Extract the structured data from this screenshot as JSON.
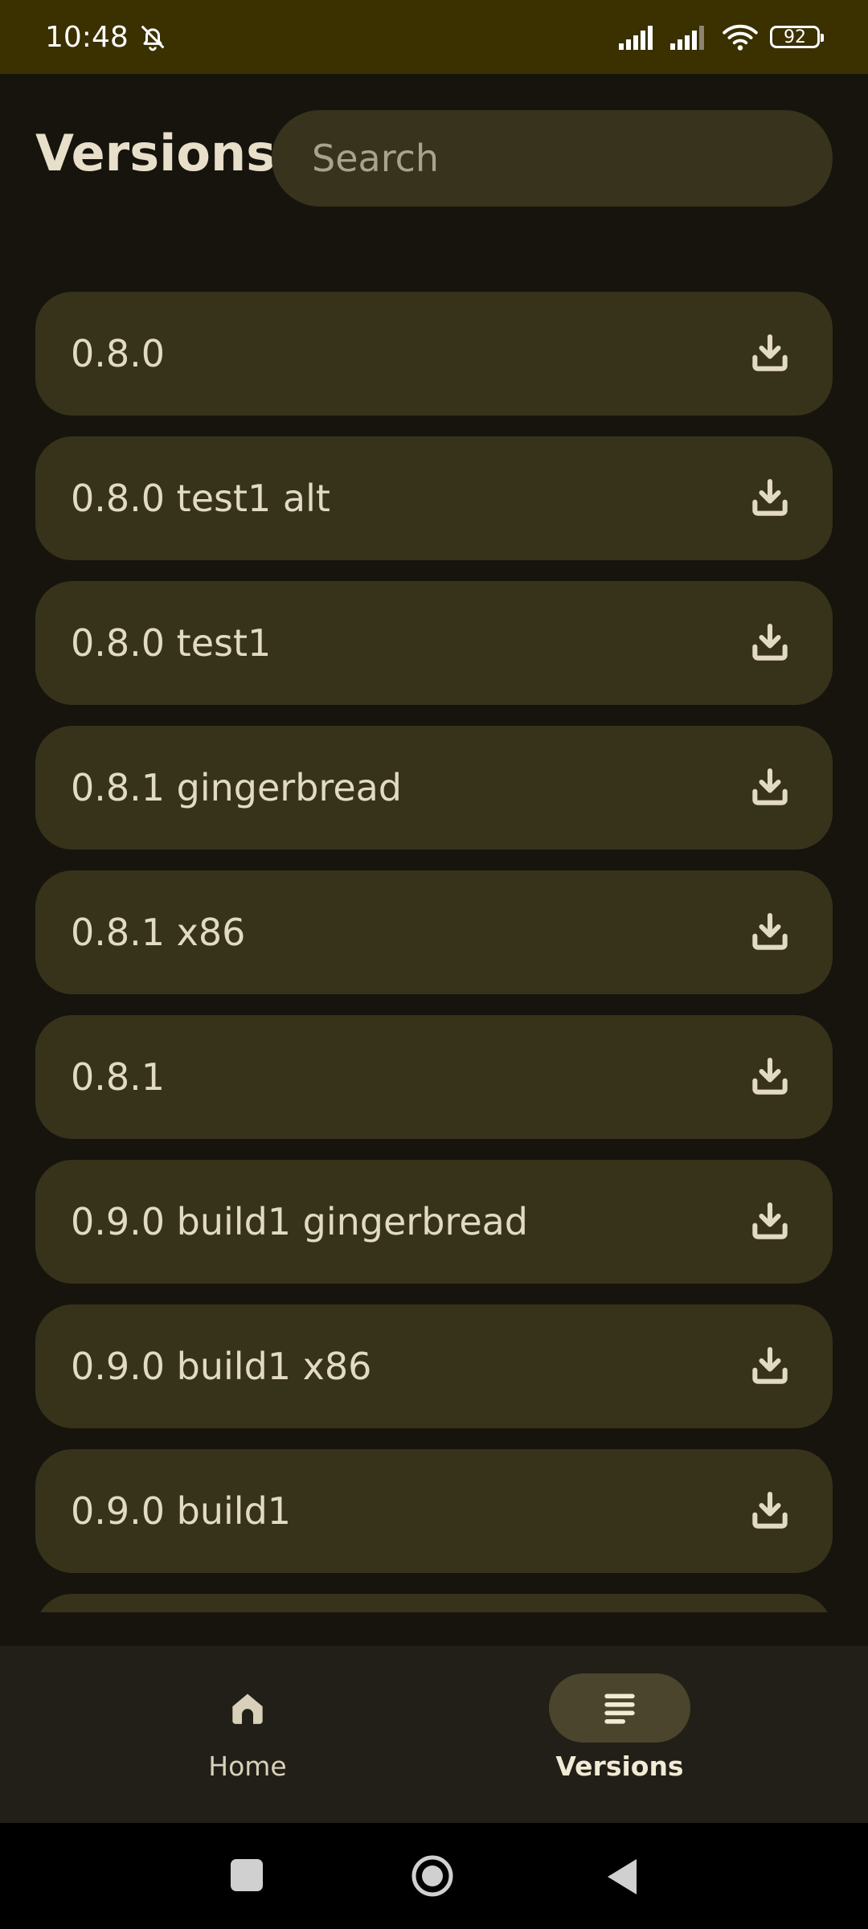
{
  "status_bar": {
    "time": "10:48",
    "battery": "92",
    "icons": [
      "bell-off-icon",
      "signal-icon",
      "signal-icon",
      "wifi-icon",
      "battery-icon"
    ]
  },
  "header": {
    "title": "Versions",
    "search_placeholder": "Search"
  },
  "versions": [
    "0.8.0",
    "0.8.0 test1 alt",
    "0.8.0 test1",
    "0.8.1 gingerbread",
    "0.8.1 x86",
    "0.8.1",
    "0.9.0 build1 gingerbread",
    "0.9.0 build1 x86",
    "0.9.0 build1",
    ""
  ],
  "bottom_nav": {
    "home_label": "Home",
    "versions_label": "Versions",
    "active": "Versions"
  },
  "colors": {
    "status_bar_bg": "#3a3000",
    "page_bg": "#17140d",
    "item_bg": "#37331b",
    "nav_bg": "#221f18",
    "active_pill": "#4a452c",
    "text": "#e2dac4"
  }
}
